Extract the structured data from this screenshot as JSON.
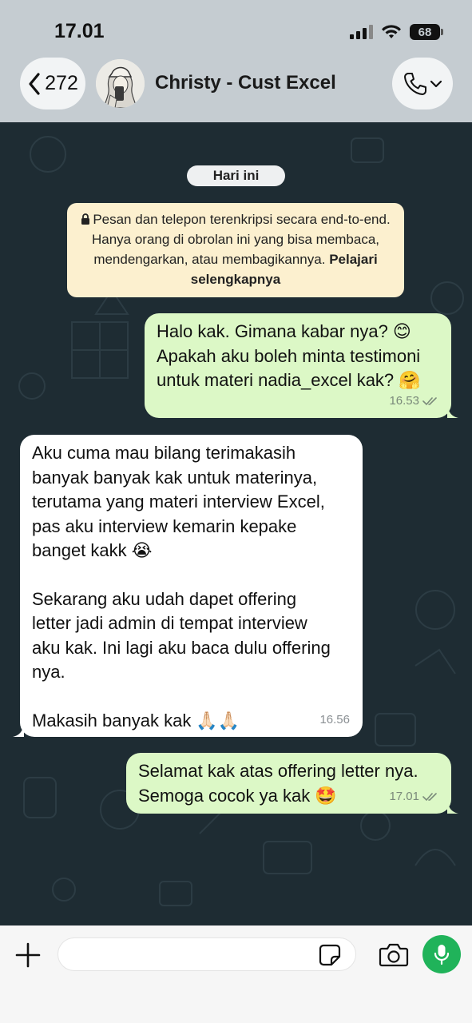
{
  "status_bar": {
    "time": "17.01",
    "battery": "68"
  },
  "header": {
    "back_count": "272",
    "contact_name": "Christy - Cust Excel"
  },
  "chat": {
    "date_label": "Hari ini",
    "encryption_notice": {
      "text": "Pesan dan telepon terenkripsi secara end-to-end. Hanya orang di obrolan ini yang bisa membaca, mendengarkan, atau membagikannya.",
      "link": "Pelajari selengkapnya"
    },
    "messages": [
      {
        "direction": "out",
        "lines": [
          "Halo kak. Gimana kabar nya? 😊",
          "Apakah aku boleh minta testimoni",
          "untuk materi nadia_excel kak? 🤗"
        ],
        "time": "16.53",
        "status": "read"
      },
      {
        "direction": "in",
        "lines": [
          "Aku cuma mau bilang terimakasih",
          "banyak banyak kak untuk materinya,",
          "terutama yang materi interview Excel,",
          "pas aku interview kemarin kepake",
          "banget kakk 😭",
          "",
          "Sekarang aku udah dapet offering",
          "letter jadi admin di tempat interview",
          "aku kak. Ini lagi aku baca dulu offering",
          "nya.",
          "",
          "Makasih banyak kak 🙏🏻🙏🏻"
        ],
        "time": "16.56"
      },
      {
        "direction": "out",
        "lines": [
          "Selamat kak atas offering letter nya.",
          "Semoga cocok ya kak 🤩"
        ],
        "time": "17.01",
        "status": "read"
      }
    ]
  },
  "input_bar": {
    "message_value": "",
    "message_placeholder": ""
  },
  "colors": {
    "header_bg": "#c5ccd1",
    "chat_bg": "#1e2c33",
    "outgoing_bubble": "#dcf8c6",
    "incoming_bubble": "#ffffff",
    "notice_bg": "#fcf0cf",
    "mic_button": "#20b35a"
  },
  "icons": {
    "back": "chevron-left-icon",
    "call": "phone-icon",
    "lock": "lock-icon",
    "read": "double-check-icon",
    "plus": "plus-icon",
    "sticker": "sticker-icon",
    "camera": "camera-icon",
    "mic": "mic-icon"
  }
}
